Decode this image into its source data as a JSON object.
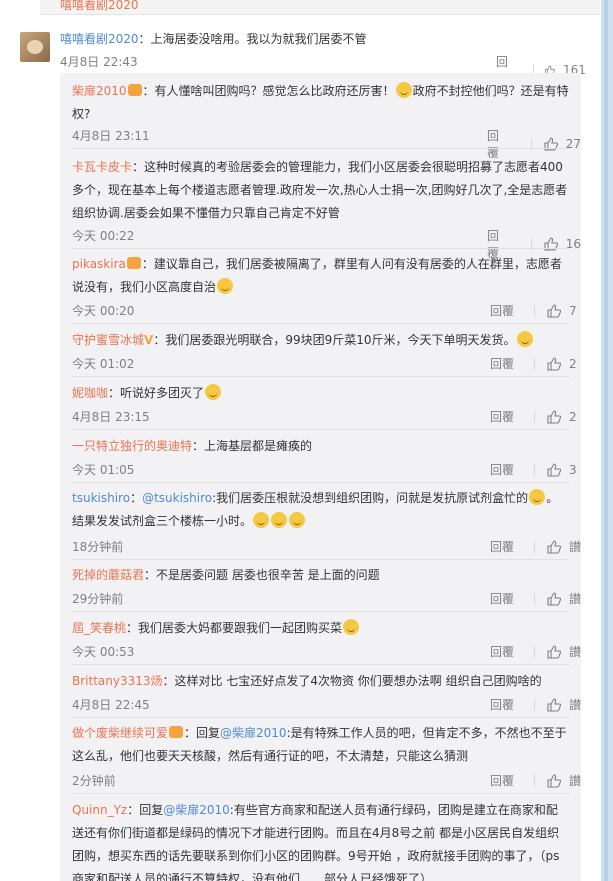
{
  "top_strip": {
    "text": "嘻嘻看剧2020"
  },
  "main_comment": {
    "username": "嘻嘻看剧2020",
    "text": "：上海居委没啥用。我以为就我们居委不管",
    "time": "4月8日 22:43",
    "reply_label": "回覆",
    "likes": "161"
  },
  "replies": [
    {
      "username": "柴扉2010",
      "badge": true,
      "before": "：有人懂啥叫团购吗？感觉怎么比政府还厉害！",
      "after": "政府不封控他们吗？还是有特权?",
      "emoji": true,
      "time": "4月8日 23:11",
      "reply_label": "回覆",
      "likes": "27"
    },
    {
      "username": "卡瓦卡皮卡",
      "before": "：这种时候真的考验居委会的管理能力，我们小区居委会很聪明招募了志愿者400多个，现在基本上每个楼道志愿者管理.政府发一次,热心人士捐一次,团购好几次了,全是志愿者组织协调.居委会如果不懂借力只靠自己肯定不好管",
      "time": "今天 00:22",
      "reply_label": "回覆",
      "likes": "16"
    },
    {
      "username": "pikaskira",
      "badge": true,
      "before": "：建议靠自己，我们居委被隔离了，群里有人问有没有居委的人在群里，志愿者说没有，我们小区高度自治",
      "emoji_end": true,
      "time": "今天 00:20",
      "reply_label": "回覆",
      "likes": "7"
    },
    {
      "username": "守护蜜雪冰城",
      "vbadge": "V",
      "before": "：我们居委跟光明联合，99块团9斤菜10斤米，今天下单明天发货。",
      "emoji_end": true,
      "time": "今天 01:02",
      "reply_label": "回覆",
      "likes": "2"
    },
    {
      "username": "妮咖咖",
      "before": "：听说好多团灭了",
      "emoji_end": true,
      "time": "4月8日 23:15",
      "reply_label": "回覆",
      "likes": "2"
    },
    {
      "username": "一只特立独行的奥迪特",
      "before": "：上海基层都是瘫痪的",
      "time": "今天 01:05",
      "reply_label": "回覆",
      "likes": "3"
    },
    {
      "username": "tsukishiro",
      "blue": true,
      "mention": "@tsukishiro",
      "before": "：",
      "mid": ":我们居委压根就没想到组织团购，问就是发抗原试剂盒忙的",
      "after": "。结果发发试剂盒三个楼栋一小时。",
      "emoji": true,
      "emoji3": true,
      "time": "18分钟前",
      "reply_label": "回覆",
      "likes": "讃"
    },
    {
      "username": "死掉的蘑菇君",
      "before": "：不是居委问题 居委也很辛苦 是上面的问题",
      "time": "29分钟前",
      "reply_label": "回覆",
      "likes": "讃"
    },
    {
      "username": "屆_笑春桃",
      "before": "：我们居委大妈都要跟我们一起团购买菜",
      "emoji_end": true,
      "time": "今天 00:53",
      "reply_label": "回覆",
      "likes": "讃"
    },
    {
      "username": "Brittany3313炀",
      "before": "：这样对比 七宝还好点发了4次物资 你们要想办法啊 组织自己团购啥的",
      "time": "4月8日 22:45",
      "reply_label": "回覆",
      "likes": "讃"
    },
    {
      "username": "做个废柴继续可爱",
      "badge": true,
      "before": "：回复",
      "mention": "@柴扉2010",
      "after": ":是有特殊工作人员的吧，但肯定不多，不然也不至于这么乱，他们也要天天核酸，然后有通行证的吧，不太清楚，只能这么猜测",
      "time": "2分钟前",
      "reply_label": "回覆",
      "likes": "讃"
    },
    {
      "username": "Quinn_Yz",
      "before": "：回复",
      "mention": "@柴扉2010",
      "after": ":有些官方商家和配送人员有通行绿码，团购是建立在商家和配送还有你们街道都是绿码的情况下才能进行团购。而且在4月8号之前 都是小区居民自发组织团购，想买东西的话先要联系到你们小区的团购群。9号开始 ，政府就接手团购的事了，（ps 商家和配送人员的通行不算特权，没有他们……部分人已经饿死了）"
    }
  ]
}
